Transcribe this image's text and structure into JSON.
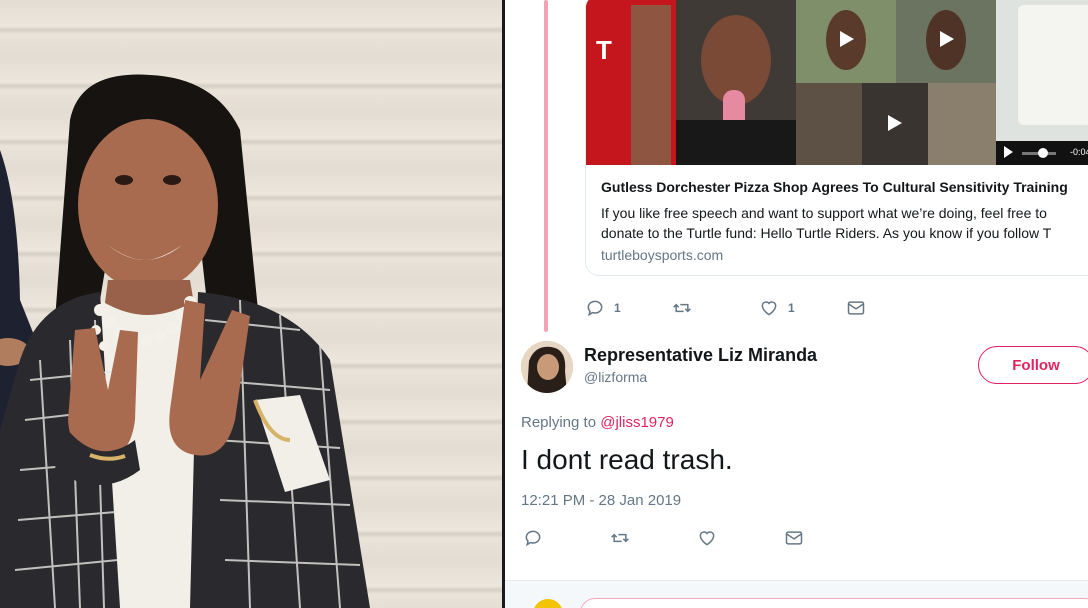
{
  "link_card": {
    "title": "Gutless Dorchester Pizza Shop Agrees To Cultural Sensitivity Training",
    "description_line1": "If you like free speech and want to support what we’re doing, feel free to",
    "description_line2": "donate to the Turtle fund: Hello Turtle Riders. As you know if you follow T",
    "domain": "turtleboysports.com",
    "video_time": "-0:04"
  },
  "parent_tweet_actions": {
    "reply_count": "1",
    "retweet_count": "",
    "like_count": "1"
  },
  "tweet": {
    "author_name": "Representative Liz Miranda",
    "author_handle": "@lizforma",
    "follow_label": "Follow",
    "replying_prefix": "Replying to ",
    "replying_to": "@jliss1979",
    "text": "I dont read trash.",
    "timestamp": "12:21 PM - 28 Jan 2019"
  },
  "colors": {
    "accent": "#e0245e",
    "secondary_text": "#657786",
    "thread_line": "#f0a3b3"
  }
}
